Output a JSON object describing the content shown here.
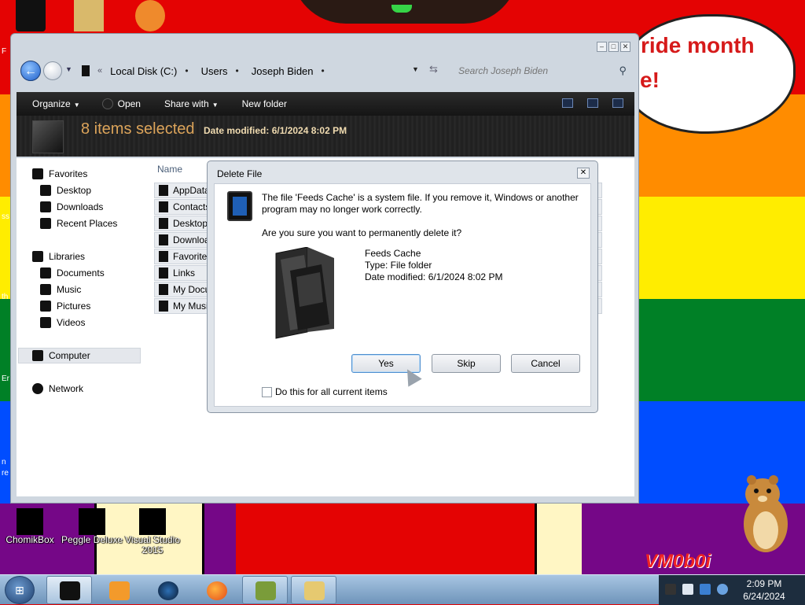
{
  "desktop": {
    "bubble_line1": "ride month",
    "bubble_line2": "e!",
    "edge_texts": [
      "F",
      "ss",
      "th",
      "Er",
      "n",
      "re"
    ],
    "icons": [
      {
        "label": "ChomikBox"
      },
      {
        "label": "Peggle Deluxe"
      },
      {
        "label": "Visual Studio 2015"
      }
    ],
    "watermark": "VM0b0i"
  },
  "explorer": {
    "window_controls": [
      "minimize",
      "maximize",
      "close"
    ],
    "breadcrumb": [
      "Local Disk (C:)",
      "Users",
      "Joseph Biden"
    ],
    "search_placeholder": "Search Joseph Biden",
    "commands": {
      "organize": "Organize",
      "open": "Open",
      "share_with": "Share with",
      "new_folder": "New folder"
    },
    "details": {
      "selection_count": "8 items selected",
      "date_label": "Date modified:",
      "date_value": "6/1/2024 8:02 PM"
    },
    "nav": {
      "favorites": "Favorites",
      "desktop": "Desktop",
      "downloads": "Downloads",
      "recent_places": "Recent Places",
      "libraries": "Libraries",
      "documents": "Documents",
      "music": "Music",
      "pictures": "Pictures",
      "videos": "Videos",
      "computer": "Computer",
      "network": "Network"
    },
    "column_name": "Name",
    "files": [
      "AppData",
      "Contacts",
      "Desktop",
      "Downloads",
      "Favorites",
      "Links",
      "My Documents",
      "My Music"
    ]
  },
  "dialog": {
    "title": "Delete File",
    "message": "The file 'Feeds Cache' is a system file. If you remove it, Windows or another program may no longer work correctly.",
    "question": "Are you sure you want to permanently delete it?",
    "file_name": "Feeds Cache",
    "file_type": "Type: File folder",
    "file_date": "Date modified: 6/1/2024 8:02 PM",
    "yes": "Yes",
    "skip": "Skip",
    "cancel": "Cancel",
    "checkbox_label": "Do this for all current items",
    "checkbox_checked": false
  },
  "taskbar": {
    "time": "2:09 PM",
    "date": "6/24/2024"
  },
  "colors": {
    "accent_selection": "#e9ecf0",
    "details_text": "#dca45a",
    "bubble_text": "#d61a1a"
  }
}
